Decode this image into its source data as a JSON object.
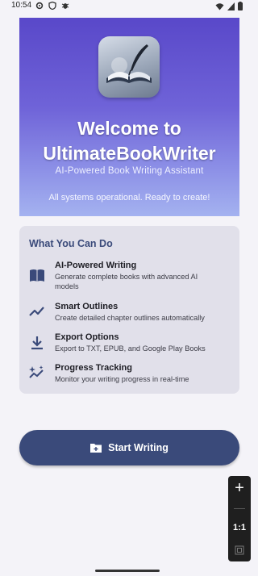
{
  "status_bar": {
    "time": "10:54",
    "icons": [
      "settings-icon",
      "shield-icon",
      "bug-icon"
    ],
    "right_icons": [
      "wifi-icon",
      "signal-icon",
      "battery-icon"
    ]
  },
  "hero": {
    "title_line1": "Welcome to",
    "title_line2": "UltimateBookWriter",
    "subtitle": "AI-Powered Book Writing Assistant",
    "status": "All systems operational. Ready to create!"
  },
  "features": {
    "title": "What You Can Do",
    "items": [
      {
        "title": "AI-Powered Writing",
        "desc": "Generate complete books with advanced AI models",
        "icon": "book-icon"
      },
      {
        "title": "Smart Outlines",
        "desc": "Create detailed chapter outlines automatically",
        "icon": "trend-icon"
      },
      {
        "title": "Export Options",
        "desc": "Export to TXT, EPUB, and Google Play Books",
        "icon": "download-icon"
      },
      {
        "title": "Progress Tracking",
        "desc": "Monitor your writing progress in real-time",
        "icon": "sparkle-chart-icon"
      }
    ]
  },
  "start_button": {
    "label": "Start Writing",
    "icon": "new-folder-icon"
  },
  "zoom": {
    "plus": "+",
    "ratio": "1:1"
  },
  "colors": {
    "accent": "#3a4a7a",
    "hero_top": "#5948c9",
    "hero_bottom": "#a4b2f0",
    "card_bg": "#e1e0ea"
  }
}
